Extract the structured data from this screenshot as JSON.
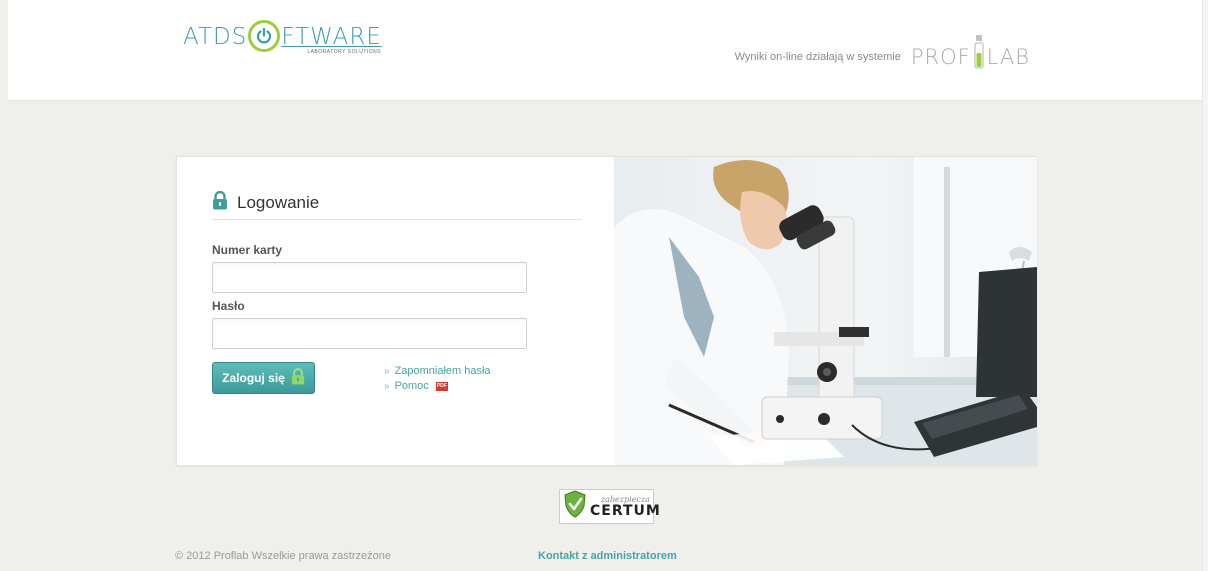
{
  "header": {
    "logo_prefix": "ATDS",
    "logo_suffix": "FTWARE",
    "logo_tagline": "LABORATORY SOLUTIONS",
    "powered_text": "Wyniki on-line działają w systemie",
    "proflab_prefix": "PROF",
    "proflab_suffix": "LAB"
  },
  "login": {
    "title": "Logowanie",
    "card_label": "Numer karty",
    "card_value": "",
    "password_label": "Hasło",
    "password_value": "",
    "submit_label": "Zaloguj się",
    "forgot_link": "Zapomniałem hasła",
    "help_link": "Pomoc",
    "link_prefix": "»"
  },
  "badge": {
    "small": "zabezpiecza",
    "big": "CERTUM"
  },
  "footer": {
    "copyright": "© 2012 Proflab Wszelkie prawa zastrzeżone",
    "contact": "Kontakt z administratorem"
  },
  "colors": {
    "accent": "#45a5a3",
    "logo_blue": "#3c9bb1",
    "logo_green": "#9dcd3a",
    "background": "#efefeb"
  },
  "icons": {
    "lock": "lock-icon",
    "pdf": "pdf-icon",
    "power": "power-icon"
  }
}
